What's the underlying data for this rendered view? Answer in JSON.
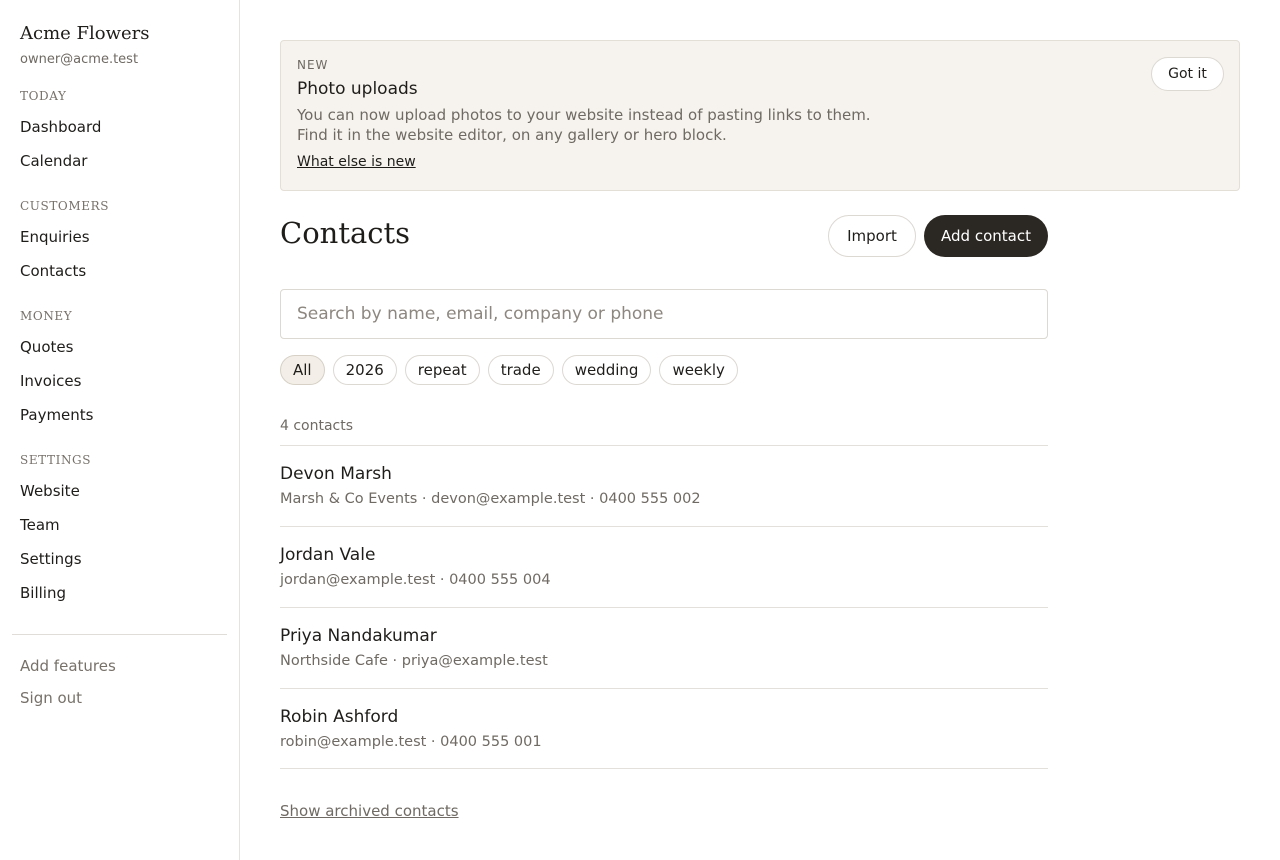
{
  "sidebar": {
    "brand": "Acme Flowers",
    "account_email": "owner@acme.test",
    "sections": [
      {
        "heading": "TODAY",
        "items": [
          "Dashboard",
          "Calendar"
        ]
      },
      {
        "heading": "CUSTOMERS",
        "items": [
          "Enquiries",
          "Contacts"
        ]
      },
      {
        "heading": "MONEY",
        "items": [
          "Quotes",
          "Invoices",
          "Payments"
        ]
      },
      {
        "heading": "SETTINGS",
        "items": [
          "Website",
          "Team",
          "Settings",
          "Billing"
        ]
      }
    ],
    "footer": {
      "add_features": "Add features",
      "sign_out": "Sign out"
    }
  },
  "banner": {
    "tag": "NEW",
    "title": "Photo uploads",
    "lines": [
      "You can now upload photos to your website instead of pasting links to them.",
      "Find it in the website editor, on any gallery or hero block."
    ],
    "link": "What else is new",
    "dismiss": "Got it"
  },
  "header": {
    "title": "Contacts",
    "import_label": "Import",
    "add_label": "Add contact"
  },
  "search": {
    "placeholder": "Search by name, email, company or phone",
    "value": ""
  },
  "filters": {
    "chips": [
      "All",
      "2026",
      "repeat",
      "trade",
      "wedding",
      "weekly"
    ],
    "selected": "All"
  },
  "list": {
    "count_label": "4 contacts",
    "contacts": [
      {
        "name": "Devon Marsh",
        "meta": "Marsh & Co Events · devon@example.test · 0400 555 002"
      },
      {
        "name": "Jordan Vale",
        "meta": "jordan@example.test · 0400 555 004"
      },
      {
        "name": "Priya Nandakumar",
        "meta": "Northside Cafe · priya@example.test"
      },
      {
        "name": "Robin Ashford",
        "meta": "robin@example.test · 0400 555 001"
      }
    ],
    "archived_link": "Show archived contacts"
  }
}
